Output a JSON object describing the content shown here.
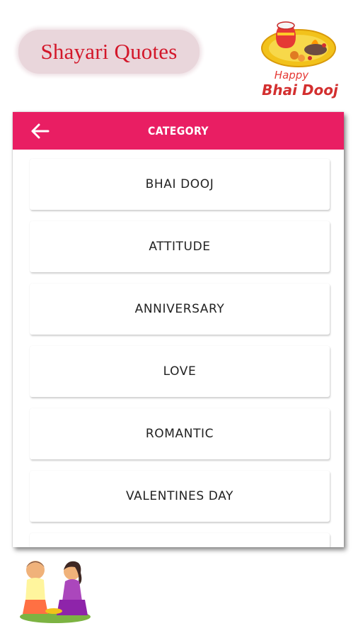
{
  "promo": {
    "title": "Shayari Quotes",
    "logo_line1": "Happy",
    "logo_line2": "Bhai Dooj"
  },
  "toolbar": {
    "title": "CATEGORY",
    "back_icon": "arrow-left-icon"
  },
  "categories": [
    {
      "label": "BHAI DOOJ"
    },
    {
      "label": "ATTITUDE"
    },
    {
      "label": "ANNIVERSARY"
    },
    {
      "label": "LOVE"
    },
    {
      "label": "ROMANTIC"
    },
    {
      "label": "VALENTINES DAY"
    }
  ],
  "colors": {
    "accent": "#e91e63",
    "promo_text": "#d3172a",
    "promo_bg": "#e9d6db"
  }
}
